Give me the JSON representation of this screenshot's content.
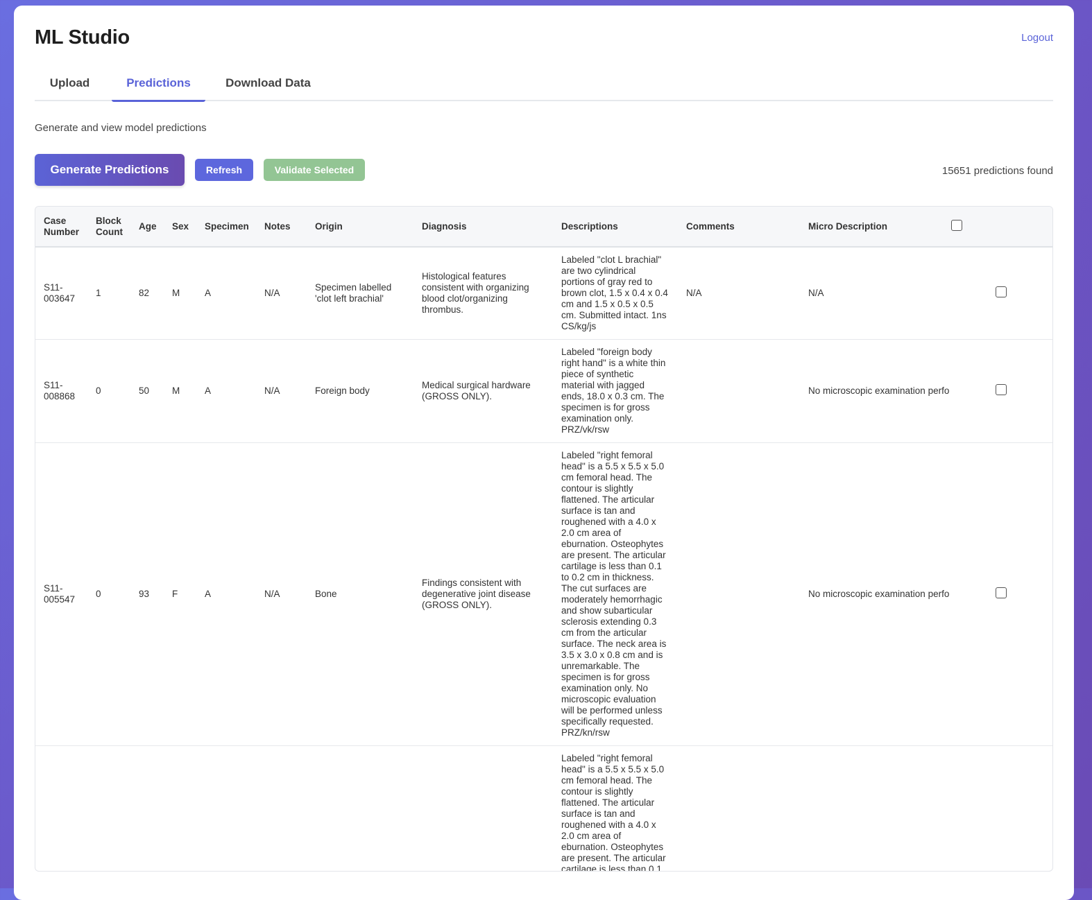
{
  "app": {
    "title": "ML Studio",
    "logout": "Logout"
  },
  "tabs": [
    {
      "label": "Upload",
      "active": false
    },
    {
      "label": "Predictions",
      "active": true
    },
    {
      "label": "Download Data",
      "active": false
    }
  ],
  "page": {
    "subtitle": "Generate and view model predictions",
    "generate_label": "Generate Predictions",
    "refresh_label": "Refresh",
    "validate_label": "Validate Selected",
    "count_text": "15651 predictions found"
  },
  "colors": {
    "accent": "#5a63d8",
    "validate": "#93c594",
    "background": "#6a5bd0"
  },
  "table": {
    "headers": {
      "case_number": "Case Number",
      "block_count": "Block Count",
      "age": "Age",
      "sex": "Sex",
      "specimen": "Specimen",
      "notes": "Notes",
      "origin": "Origin",
      "diagnosis": "Diagnosis",
      "descriptions": "Descriptions",
      "comments": "Comments",
      "micro_description": "Micro Description"
    },
    "rows": [
      {
        "case_number": "S11-003647",
        "block_count": "1",
        "age": "82",
        "sex": "M",
        "specimen": "A",
        "notes": "N/A",
        "origin": "Specimen labelled 'clot left brachial'",
        "diagnosis": "Histological features consistent with organizing blood clot/organizing thrombus.",
        "descriptions": "Labeled \"clot L brachial\" are two cylindrical portions of gray red to brown clot, 1.5 x 0.4 x 0.4 cm and 1.5 x 0.5 x 0.5 cm. Submitted intact. 1ns CS/kg/js",
        "comments": "N/A",
        "micro_description": "N/A"
      },
      {
        "case_number": "S11-008868",
        "block_count": "0",
        "age": "50",
        "sex": "M",
        "specimen": "A",
        "notes": "N/A",
        "origin": "Foreign body",
        "diagnosis": "Medical surgical hardware (GROSS ONLY).",
        "descriptions": "Labeled \"foreign body right hand\" is a white thin piece of synthetic material with jagged ends, 18.0 x 0.3 cm. The specimen is for gross examination only. PRZ/vk/rsw",
        "comments": "",
        "micro_description": "No microscopic examination performed."
      },
      {
        "case_number": "S11-005547",
        "block_count": "0",
        "age": "93",
        "sex": "F",
        "specimen": "A",
        "notes": "N/A",
        "origin": "Bone",
        "diagnosis": "Findings consistent with degenerative joint disease (GROSS ONLY).",
        "descriptions": "Labeled \"right femoral head\" is a 5.5 x 5.5 x 5.0 cm femoral head. The contour is slightly flattened. The articular surface is tan and roughened with a 4.0 x 2.0 cm area of eburnation. Osteophytes are present. The articular cartilage is less than 0.1 to 0.2 cm in thickness. The cut surfaces are moderately hemorrhagic and show subarticular sclerosis extending 0.3 cm from the articular surface. The neck area is 3.5 x 3.0 x 0.8 cm and is unremarkable. The specimen is for gross examination only. No microscopic evaluation will be performed unless specifically requested. PRZ/kn/rsw",
        "comments": "",
        "micro_description": "No microscopic examination performed."
      },
      {
        "case_number": "",
        "block_count": "",
        "age": "",
        "sex": "",
        "specimen": "",
        "notes": "",
        "origin": "",
        "diagnosis": "",
        "descriptions": "Labeled \"right femoral head\" is a 5.5 x 5.5 x 5.0 cm femoral head. The contour is slightly flattened. The articular surface is tan and roughened with a 4.0 x 2.0 cm area of eburnation. Osteophytes are present. The articular cartilage is less than 0.1",
        "comments": "",
        "micro_description": ""
      }
    ]
  }
}
